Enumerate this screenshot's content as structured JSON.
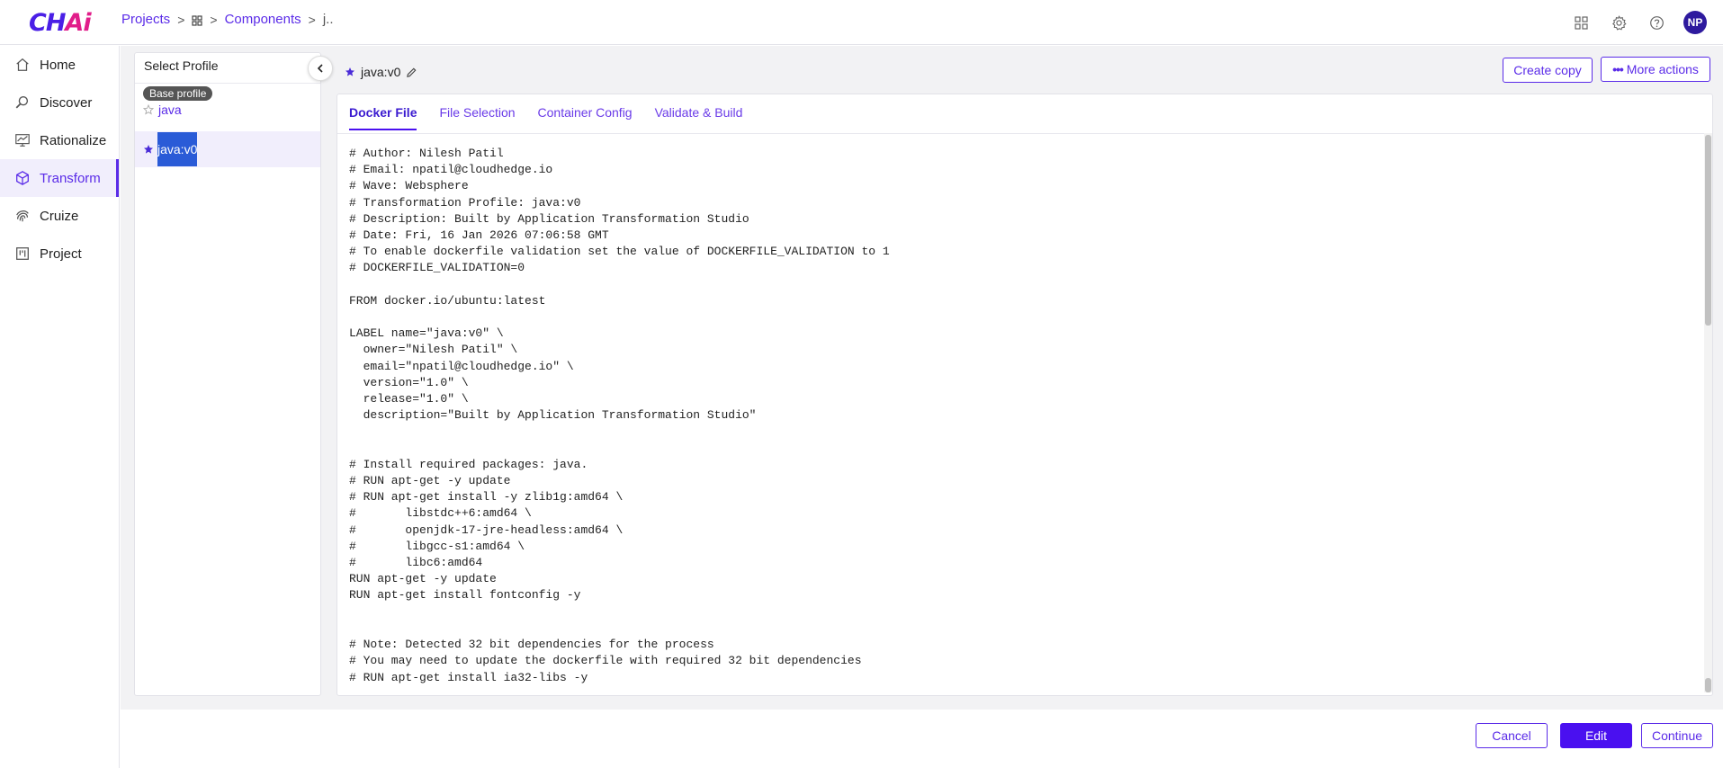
{
  "header": {
    "logo_main": "CH",
    "logo_accent": "Ai",
    "breadcrumb": {
      "projects": "Projects",
      "components": "Components",
      "current": "j.."
    },
    "avatar_initials": "NP"
  },
  "sidebar": {
    "items": [
      {
        "label": "Home",
        "icon": "home-icon"
      },
      {
        "label": "Discover",
        "icon": "discover-icon"
      },
      {
        "label": "Rationalize",
        "icon": "chart-icon"
      },
      {
        "label": "Transform",
        "icon": "cube-icon",
        "active": true
      },
      {
        "label": "Cruize",
        "icon": "fingerprint-icon"
      },
      {
        "label": "Project",
        "icon": "board-icon"
      }
    ]
  },
  "profile_panel": {
    "title": "Select Profile",
    "base_badge": "Base profile",
    "profiles": [
      "java",
      "java:v0"
    ]
  },
  "main": {
    "profile_name": "java:v0",
    "create_copy": "Create copy",
    "more_actions": "More actions",
    "tabs": [
      "Docker File",
      "File Selection",
      "Container Config",
      "Validate & Build"
    ],
    "dockerfile": [
      "# Author: Nilesh Patil",
      "# Email: npatil@cloudhedge.io",
      "# Wave: Websphere",
      "# Transformation Profile: java:v0",
      "# Description: Built by Application Transformation Studio",
      "# Date: Fri, 16 Jan 2026 07:06:58 GMT",
      "# To enable dockerfile validation set the value of DOCKERFILE_VALIDATION to 1",
      "# DOCKERFILE_VALIDATION=0",
      "",
      "FROM docker.io/ubuntu:latest",
      "",
      "LABEL name=\"java:v0\" \\",
      "  owner=\"Nilesh Patil\" \\",
      "  email=\"npatil@cloudhedge.io\" \\",
      "  version=\"1.0\" \\",
      "  release=\"1.0\" \\",
      "  description=\"Built by Application Transformation Studio\"",
      "",
      "",
      "# Install required packages: java.",
      "# RUN apt-get -y update",
      "# RUN apt-get install -y zlib1g:amd64 \\",
      "#       libstdc++6:amd64 \\",
      "#       openjdk-17-jre-headless:amd64 \\",
      "#       libgcc-s1:amd64 \\",
      "#       libc6:amd64",
      "RUN apt-get -y update",
      "RUN apt-get install fontconfig -y",
      "",
      "",
      "# Note: Detected 32 bit dependencies for the process",
      "# You may need to update the dockerfile with required 32 bit dependencies",
      "# RUN apt-get install ia32-libs -y"
    ]
  },
  "footer": {
    "cancel": "Cancel",
    "edit": "Edit",
    "continue": "Continue"
  },
  "colors": {
    "accent": "#5a2be8",
    "primary_button": "#4a10f0",
    "selection": "#2a5bd7"
  }
}
